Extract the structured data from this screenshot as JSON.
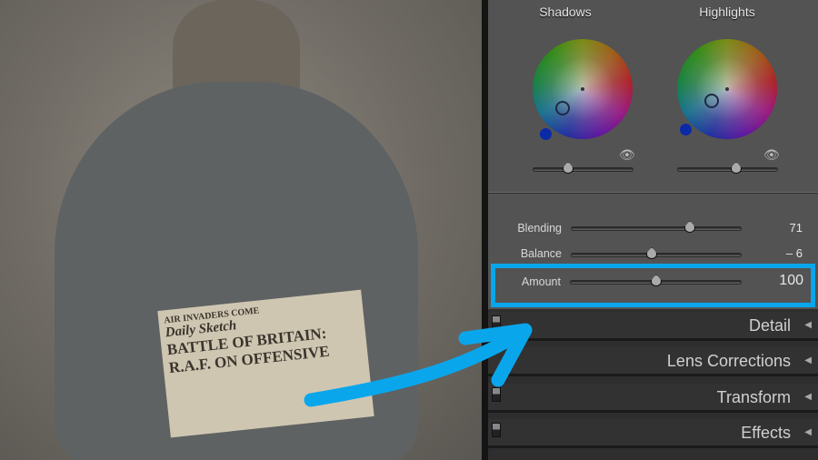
{
  "photo": {
    "newspaper": {
      "banner": "AIR INVADERS COME",
      "masthead": "Daily Sketch",
      "headline1": "BATTLE OF BRITAIN:",
      "headline2": "R.A.F. ON OFFENSIVE"
    }
  },
  "panel": {
    "wheels": [
      {
        "title": "Shadows"
      },
      {
        "title": "Highlights"
      }
    ],
    "sliders": [
      {
        "label": "Blending",
        "value": "71",
        "pos": 0.71
      },
      {
        "label": "Balance",
        "value": "– 6",
        "pos": 0.47
      },
      {
        "label": "Amount",
        "value": "100",
        "pos": 0.5
      }
    ],
    "sections": [
      {
        "title": "Detail"
      },
      {
        "title": "Lens Corrections"
      },
      {
        "title": "Transform"
      },
      {
        "title": "Effects"
      }
    ]
  },
  "colors": {
    "highlight": "#0aa6ec"
  }
}
